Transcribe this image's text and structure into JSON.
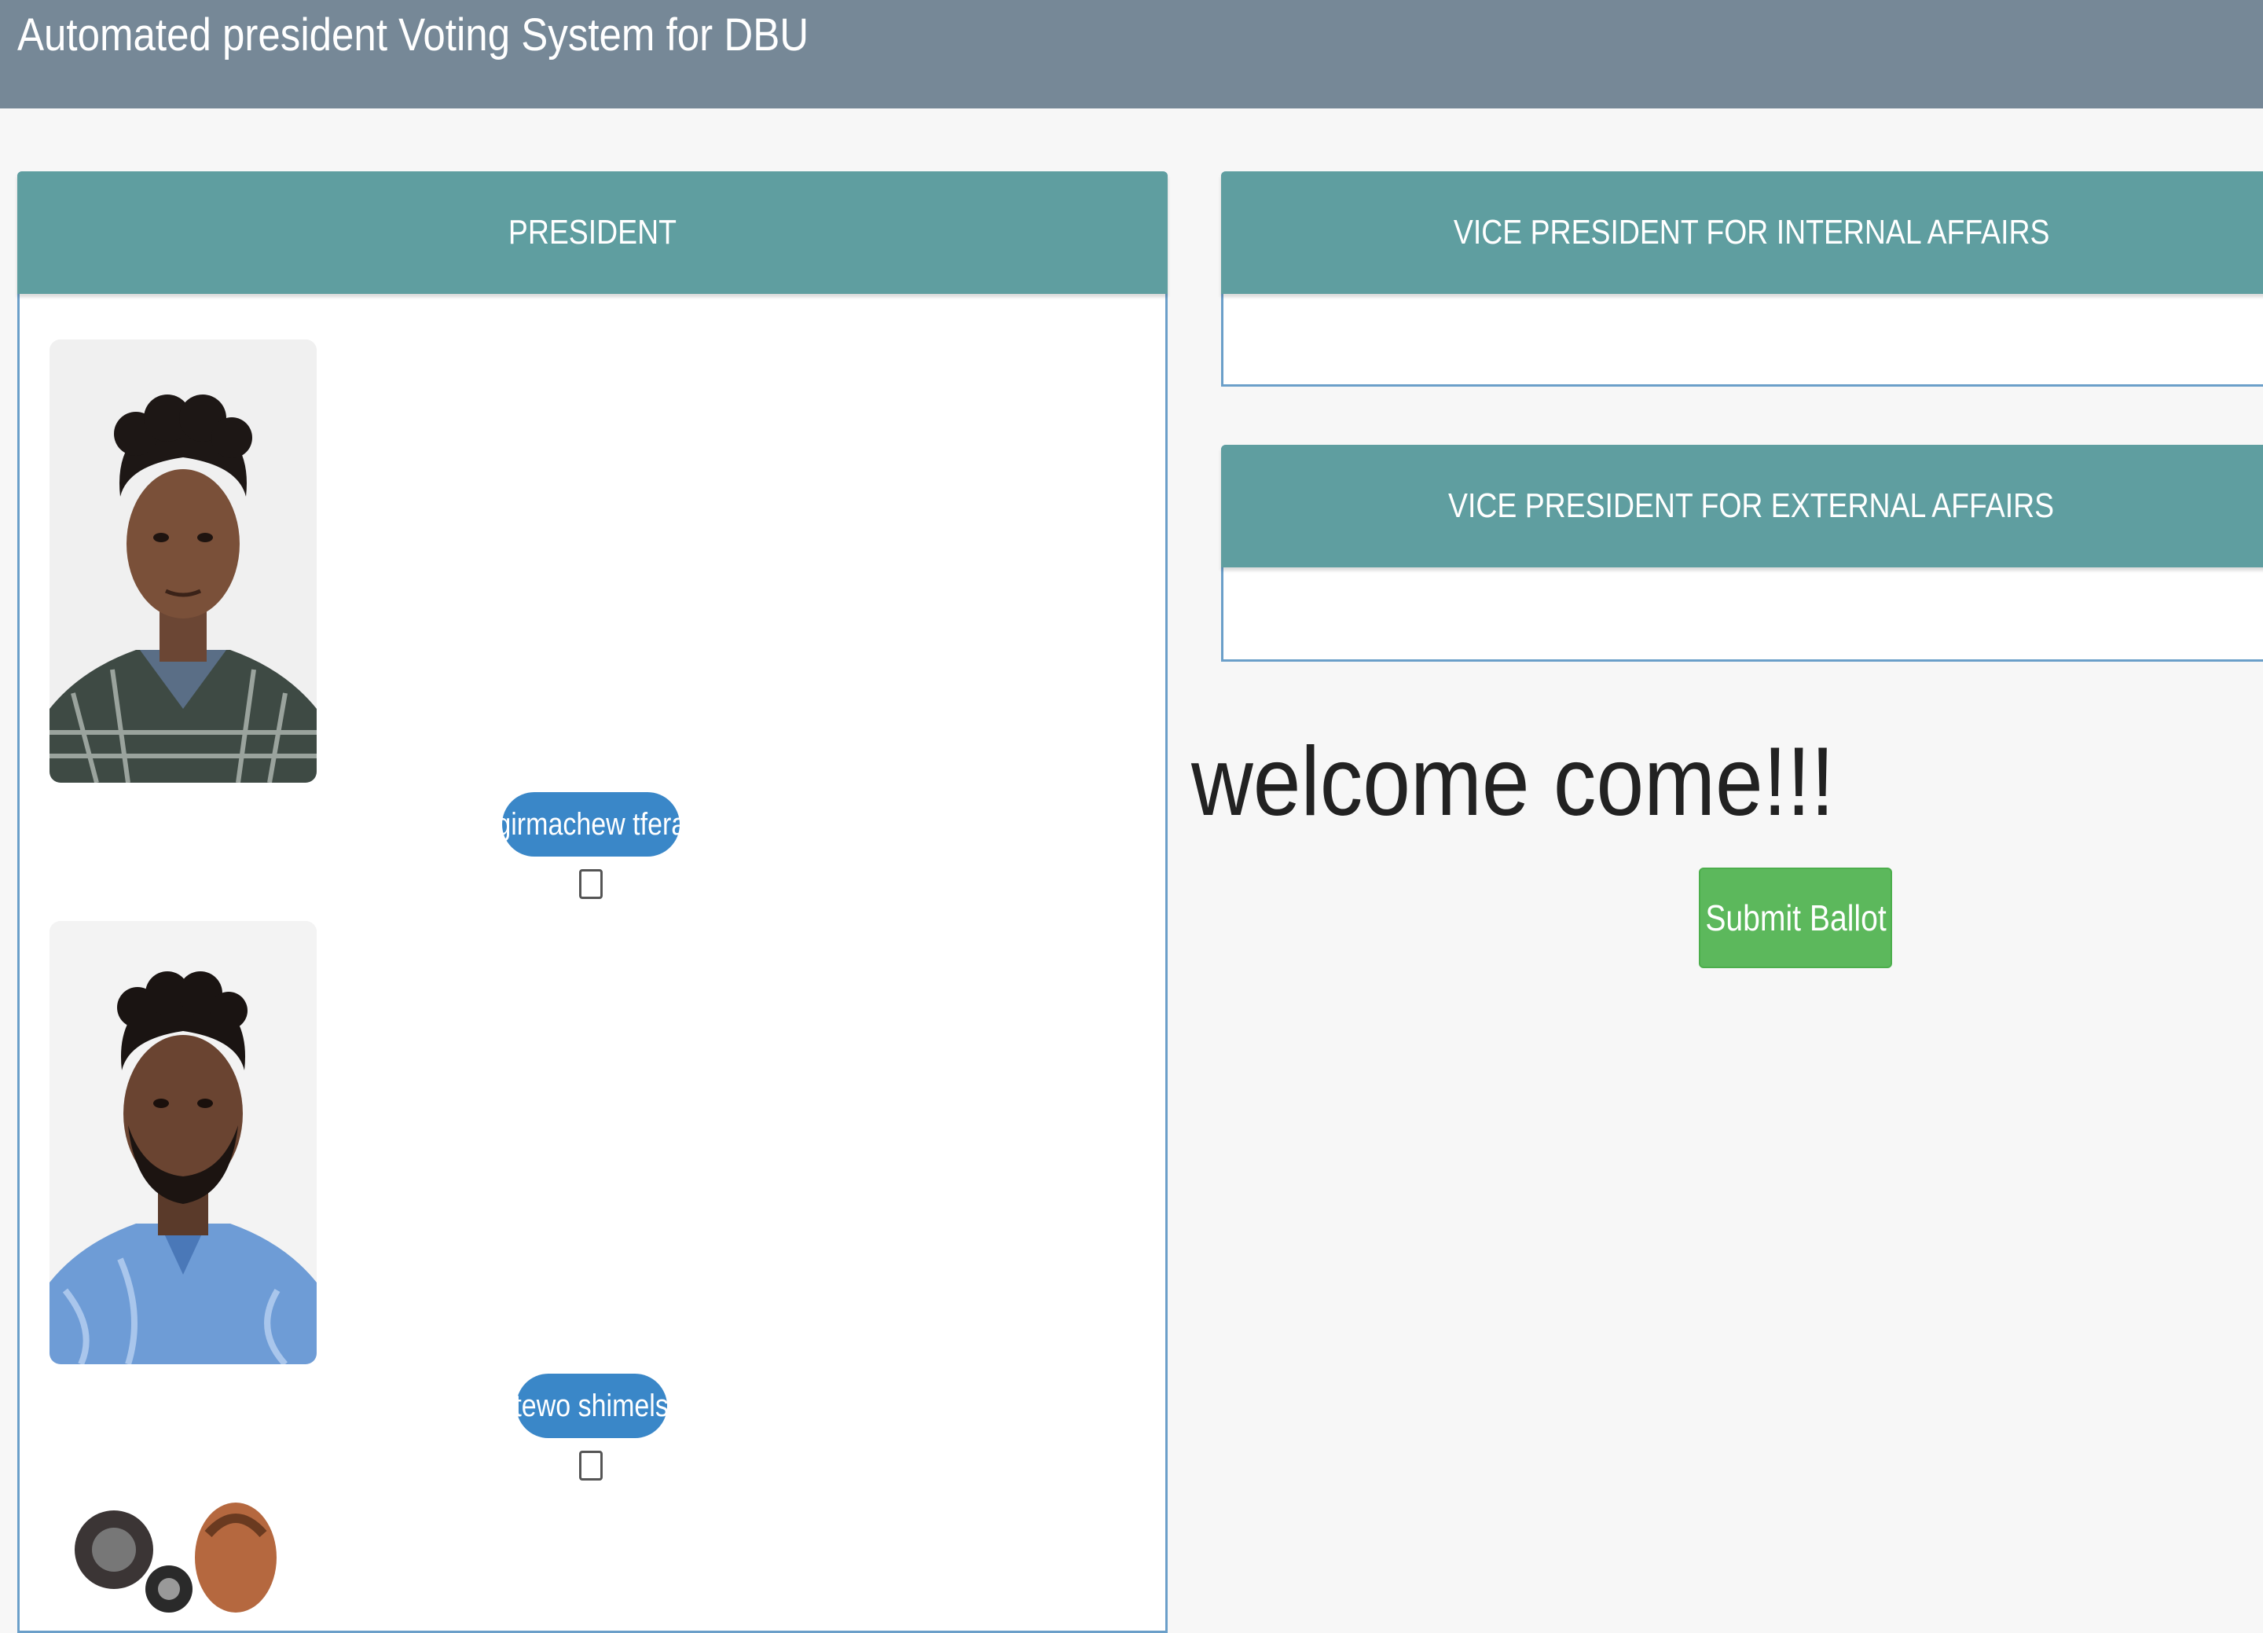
{
  "header": {
    "title": "Automated president Voting System for DBU"
  },
  "positions": {
    "president": {
      "title": "PRESIDENT",
      "candidates": [
        {
          "name": "girmachew tfera"
        },
        {
          "name": "tewo shimels"
        }
      ]
    },
    "vp_internal": {
      "title": "VICE PRESIDENT FOR INTERNAL AFFAIRS"
    },
    "vp_external": {
      "title": "VICE PRESIDENT FOR EXTERNAL AFFAIRS"
    }
  },
  "welcome_text": "welcome come!!!",
  "submit_label": "Submit Ballot",
  "colors": {
    "header_bg": "#768897",
    "panel_head_bg": "#5f9ea0",
    "name_pill_bg": "#3a87c8",
    "submit_bg": "#5cb85c"
  }
}
